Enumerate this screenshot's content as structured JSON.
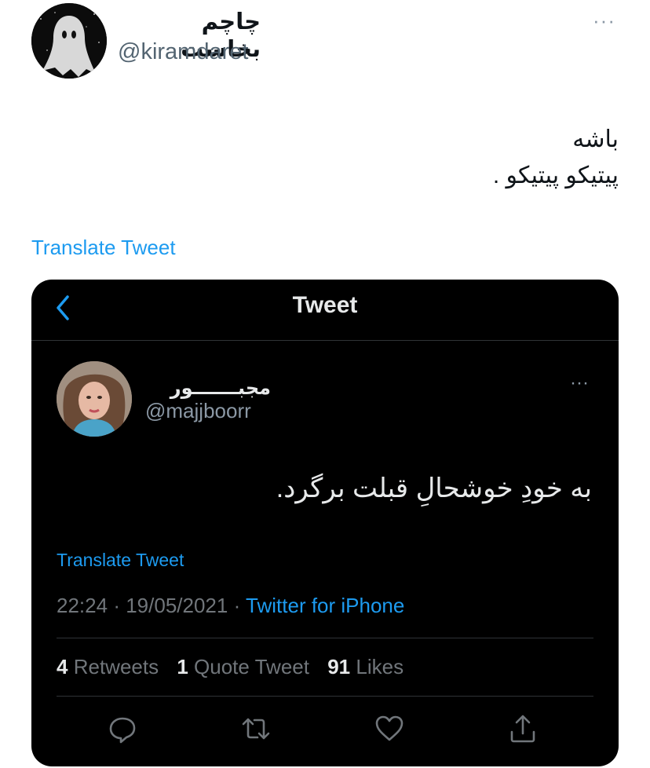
{
  "outer_tweet": {
    "display_name": "چاچم بخاست",
    "handle": "@kiramdaret",
    "more_label": "···",
    "text_lines": [
      "باشه",
      "پیتیکو پیتیکو ."
    ],
    "translate_label": "Translate Tweet"
  },
  "embedded": {
    "header_title": "Tweet",
    "back_icon": "chevron-left-icon",
    "tweet": {
      "display_name": "مجبـــــــور",
      "handle": "@majjboorr",
      "more_label": "···",
      "text": "به خودِ خوشحالِ قبلت برگرد.",
      "translate_label": "Translate Tweet",
      "time": "22:24",
      "date": "19/05/2021",
      "source": "Twitter for iPhone",
      "dot": "·"
    },
    "stats": {
      "retweets_count": "4",
      "retweets_label": "Retweets",
      "quotes_count": "1",
      "quotes_label": "Quote Tweet",
      "likes_count": "91",
      "likes_label": "Likes"
    },
    "actions": [
      "reply-icon",
      "retweet-icon",
      "like-icon",
      "share-icon"
    ]
  },
  "colors": {
    "link_blue": "#1d9bf0",
    "embed_bg": "#000000",
    "muted_gray": "#71767b"
  }
}
